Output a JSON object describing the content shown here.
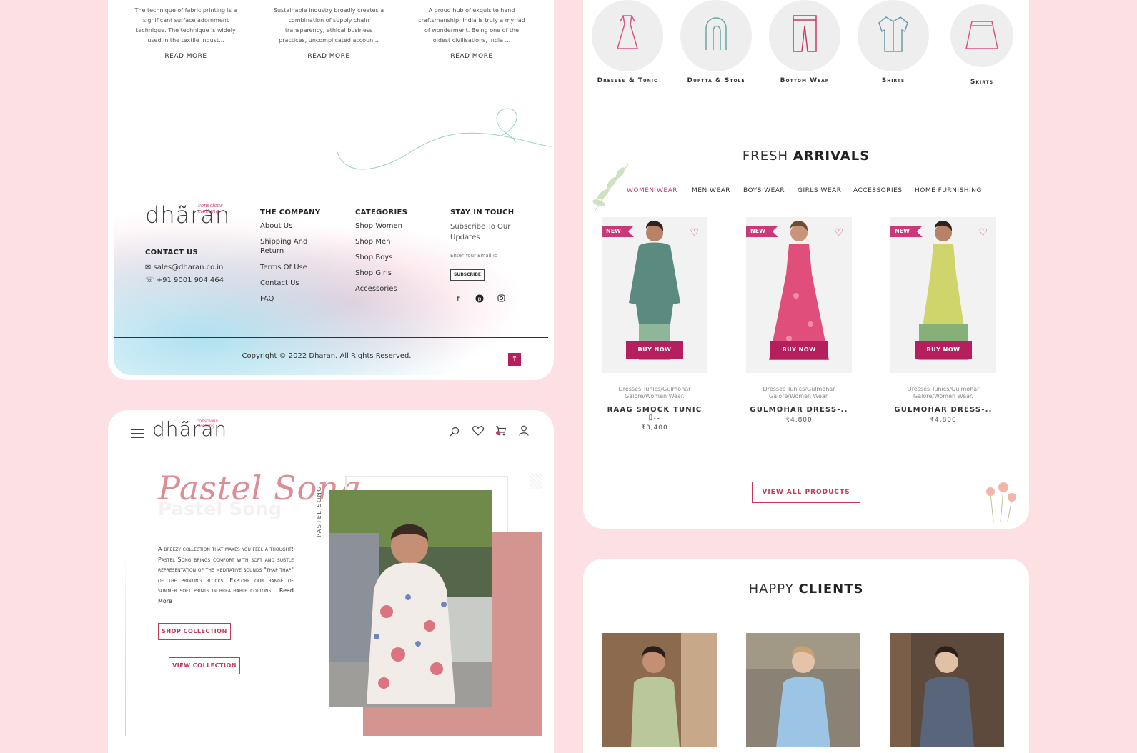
{
  "blog": [
    {
      "text": "The technique of fabric printing is a significant surface adornment technique. The technique is widely used in the textile indust...",
      "link": "READ MORE"
    },
    {
      "text": "Sustainable industry broadly creates a combination of supply chain transparency, ethical business practices, uncomplicated accoun...",
      "link": "READ MORE"
    },
    {
      "text": "A proud hub of exquisite hand craftsmanship, India is truly a myriad of wonderment. Being one of the oldest civilisations, India ...",
      "link": "READ MORE"
    }
  ],
  "brand": {
    "name": "dhãran",
    "tagline": "conscious clothing"
  },
  "footer": {
    "contact_heading": "CONTACT US",
    "email": "sales@dharan.co.in",
    "phone": "+91 9001 904 464",
    "company_heading": "THE COMPANY",
    "company_links": [
      "About Us",
      "Shipping And Return",
      "Terms Of Use",
      "Contact Us",
      "FAQ"
    ],
    "categories_heading": "CATEGORIES",
    "category_links": [
      "Shop Women",
      "Shop Men",
      "Shop Boys",
      "Shop Girls",
      "Accessories"
    ],
    "touch_heading": "STAY IN TOUCH",
    "touch_text": "Subscribe To Our Updates",
    "email_placeholder": "Enter Your Email Id",
    "subscribe_label": "SUBSCRIBE",
    "social": [
      "facebook-icon",
      "pinterest-icon",
      "instagram-icon"
    ],
    "copyright": "Copyright © 2022 Dharan. All Rights Reserved."
  },
  "hero": {
    "title": "Pastel Song",
    "ghost_title": "Pastel Song",
    "side_label": "PASTEL SONG",
    "description": "A breezy collection that makes you feel a thought! Pastel Song brings comfort with soft and subtle representation of the meditative sounds \"thap thap\" of the printing blocks. Explore our range of summer soft prints in breathable cottons...",
    "read_more": "Read More",
    "shop_button": "SHOP COLLECTION",
    "view_button": "VIEW COLLECTION"
  },
  "categories": [
    {
      "label": "Dresses & Tunic",
      "icon": "dress-icon"
    },
    {
      "label": "Duptta & Stole",
      "icon": "stole-icon"
    },
    {
      "label": "Bottom Wear",
      "icon": "trousers-icon"
    },
    {
      "label": "Shirts",
      "icon": "shirt-icon"
    },
    {
      "label": "Skirts",
      "icon": "skirt-icon"
    }
  ],
  "arrivals": {
    "title_light": "FRESH ",
    "title_bold": "ARRIVALS",
    "tabs": [
      "WOMEN WEAR",
      "MEN WEAR",
      "BOYS WEAR",
      "GIRLS WEAR",
      "ACCESSORIES",
      "HOME FURNISHING"
    ],
    "active_tab": "WOMEN WEAR",
    "products": [
      {
        "badge": "NEW",
        "button": "BUY NOW",
        "category": "Dresses Tunics/Gulmohar Galore/Women Wear.",
        "name": "RAAG SMOCK TUNIC ▯..",
        "price": "₹3,400"
      },
      {
        "badge": "NEW",
        "button": "BUY NOW",
        "category": "Dresses Tunics/Gulmohar Galore/Women Wear.",
        "name": "GULMOHAR DRESS-..",
        "price": "₹4,800"
      },
      {
        "badge": "NEW",
        "button": "BUY NOW",
        "category": "Dresses Tunics/Gulmohar Galore/Women Wear.",
        "name": "GULMOHAR DRESS-..",
        "price": "₹4,800"
      }
    ],
    "view_all": "VIEW ALL PRODUCTS"
  },
  "clients": {
    "title_light": "HAPPY ",
    "title_bold": "CLIENTS"
  },
  "colors": {
    "brand_pink": "#c93978",
    "background": "#fde0e4",
    "accent_rose": "#d4948f"
  }
}
